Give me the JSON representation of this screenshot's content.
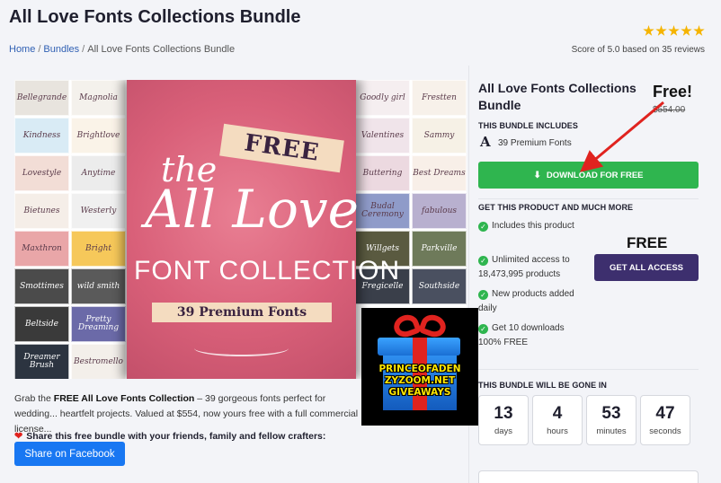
{
  "header": {
    "title": "All Love Fonts Collections Bundle",
    "breadcrumb": [
      "Home",
      "Bundles",
      "All Love Fonts Collections Bundle"
    ],
    "score_text": "Score of 5.0 based on 35 reviews",
    "rating_stars": 5
  },
  "hero": {
    "ribbon": "FREE",
    "the": "the",
    "title": "All Love",
    "subtitle": "FONT COLLECTION",
    "count_banner": "39 Premium Fonts",
    "left_tiles": [
      "Bellegrande",
      "Magnolia",
      "Kindness",
      "Brightlove",
      "Lovestyle",
      "Anytime",
      "Bietunes",
      "Westerly",
      "Maxthron",
      "Bright",
      "Smottimes",
      "wild smith",
      "Beltside",
      "Pretty Dreaming",
      "Dreamer Brush",
      "Bestromello"
    ],
    "right_tiles": [
      "Goodly girl",
      "Frestten",
      "Valentines",
      "Sammy",
      "Buttering",
      "Best Dreams",
      "Budal Ceremony",
      "fabulous",
      "Willgets",
      "Parkville",
      "Fregicelle",
      "Southside"
    ],
    "tile_colors": [
      "#e8e4de",
      "#f4f1ec",
      "#d9ebf5",
      "#faf3e8",
      "#f2ddd6",
      "#ececec",
      "#f5eee8",
      "#f0f0f0",
      "#e9a6a8",
      "#f6c85a",
      "#4b4b4b",
      "#5a5a5a",
      "#3a3a3a",
      "#6b6aa8",
      "#2c3440",
      "#f3efea"
    ]
  },
  "giveaway": {
    "text": "PRINCEOFADEN\nZYZOOM.NET\nGIVEAWAYS"
  },
  "description": {
    "lead": "Grab the ",
    "bold": "FREE All Love Fonts Collection",
    "rest": " – 39 gorgeous fonts perfect for wedding... heartfelt projects. Valued at $554, now yours free with a full commercial license...",
    "share_text": "Share this free bundle with your friends, family and fellow crafters:",
    "facebook_button": "Share on Facebook"
  },
  "sidebar": {
    "bundle_title": "All Love Fonts Collections Bundle",
    "free_label": "Free!",
    "old_price": "$554.00",
    "includes_label": "THIS BUNDLE INCLUDES",
    "font_glyph": "A",
    "fonts_count": "39 Premium Fonts",
    "download_button": "DOWNLOAD FOR FREE",
    "get_label": "GET THIS PRODUCT AND MUCH MORE",
    "perks": [
      "Includes this product",
      "Unlimited access to 18,473,995 products",
      "New products added daily",
      "Get 10 downloads 100% FREE"
    ],
    "access_free": "FREE",
    "access_button": "GET ALL ACCESS",
    "countdown_label": "THIS BUNDLE WILL BE GONE IN",
    "countdown": [
      {
        "value": "13",
        "unit": "days"
      },
      {
        "value": "4",
        "unit": "hours"
      },
      {
        "value": "53",
        "unit": "minutes"
      },
      {
        "value": "47",
        "unit": "seconds"
      }
    ]
  },
  "colors": {
    "download_green": "#2fb54f",
    "access_purple": "#3d2f6e",
    "facebook_blue": "#1877f2",
    "hero_pink": "#d96079",
    "star_gold": "#f5b400"
  }
}
